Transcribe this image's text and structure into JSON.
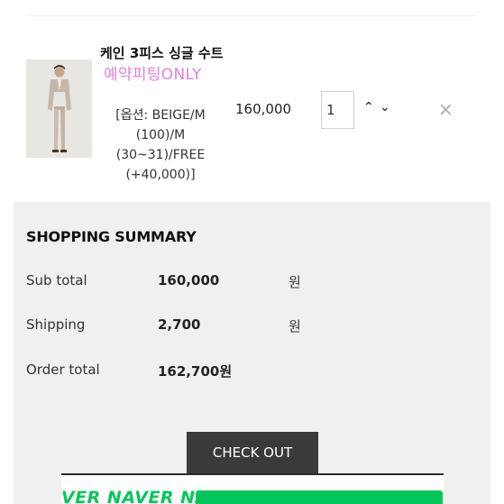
{
  "cart_item": {
    "name": "케인 3피스 싱글 수트",
    "tag": "예약피팅ONLY",
    "option": "[옵션: BEIGE/M (100)/M (30~31)/FREE (+40,000)]",
    "price": "160,000",
    "quantity": "1",
    "qty_up_icon": "chevron-up-icon",
    "qty_down_icon": "chevron-down-icon",
    "qty_up_glyph": "⌃",
    "qty_down_glyph": "⌄",
    "remove_glyph": "×"
  },
  "summary": {
    "title": "SHOPPING SUMMARY",
    "rows": [
      {
        "label": "Sub total",
        "value": "160,000",
        "unit": "원"
      },
      {
        "label": "Shipping",
        "value": "2,700",
        "unit": "원"
      },
      {
        "label": "Order total",
        "value": "162,700원",
        "unit": ""
      }
    ]
  },
  "checkout": {
    "label": "CHECK OUT"
  },
  "naver": {
    "ticker": "VER NAVER NA",
    "brand_color": "#03c75a"
  },
  "colors": {
    "accent_pink": "#e47ee0",
    "panel_bg": "#f0f0f0",
    "button_dark": "#3a3a3a"
  }
}
